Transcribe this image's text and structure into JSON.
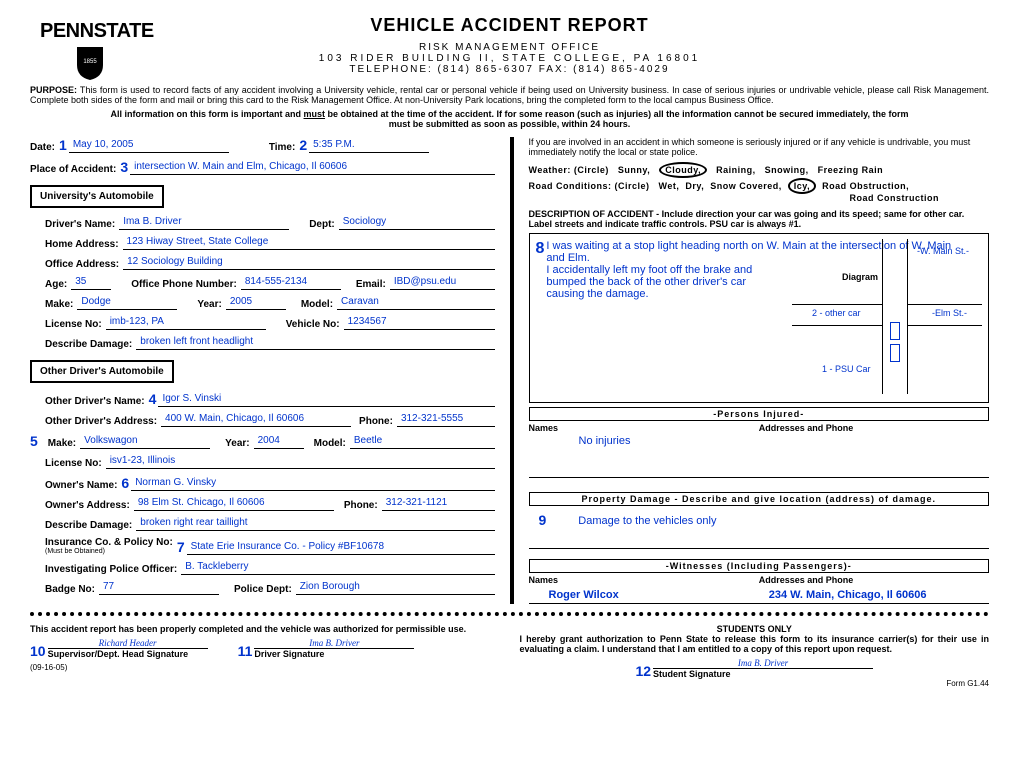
{
  "logo": {
    "text1": "PENN",
    "text2": "STATE"
  },
  "header": {
    "title": "VEHICLE ACCIDENT REPORT",
    "office": "RISK   MANAGEMENT   OFFICE",
    "address": "103  RIDER  BUILDING  II,  STATE  COLLEGE,  PA   16801",
    "phone": "TELEPHONE:  (814)  865-6307  FAX:  (814)  865-4029"
  },
  "purpose": {
    "label": "PURPOSE:",
    "text": "This form is used to record facts of any accident involving a University vehicle, rental car or personal vehicle if being used on University business.  In case of serious injuries or undrivable vehicle, please call Risk Management.  Complete both sides of the form and mail or bring this card to the Risk Management Office.  At non-University Park locations, bring the completed form to the local campus Business Office."
  },
  "important": "All information on this form is important and <u>must</u> be obtained at the time of the accident.  If for some reason (such as injuries) all the information cannot be secured immediately, the form must be submitted as soon as possible, within 24 hours.",
  "date": {
    "num": "1",
    "label": "Date:",
    "value": "May 10, 2005"
  },
  "time": {
    "num": "2",
    "label": "Time:",
    "value": "5:35 P.M."
  },
  "place": {
    "num": "3",
    "label": "Place of Accident:",
    "value": "intersection W. Main and Elm, Chicago, Il 60606"
  },
  "section1": {
    "title": "University's Automobile"
  },
  "driver": {
    "name_label": "Driver's Name:",
    "name": "Ima B. Driver",
    "dept_label": "Dept:",
    "dept": "Sociology",
    "home_label": "Home Address:",
    "home": "123 Hiway Street, State College",
    "office_label": "Office Address:",
    "office": "12 Sociology Building",
    "age_label": "Age:",
    "age": "35",
    "phone_label": "Office Phone Number:",
    "phone": "814-555-2134",
    "email_label": "Email:",
    "email": "IBD@psu.edu",
    "make_label": "Make:",
    "make": "Dodge",
    "year_label": "Year:",
    "year": "2005",
    "model_label": "Model:",
    "model": "Caravan",
    "license_label": "License No:",
    "license": "imb-123, PA",
    "vehicle_label": "Vehicle No:",
    "vehicle": "1234567",
    "damage_label": "Describe Damage:",
    "damage": "broken left front headlight"
  },
  "section2": {
    "title": "Other Driver's Automobile"
  },
  "other": {
    "num4": "4",
    "name_label": "Other Driver's Name:",
    "name": "Igor S. Vinski",
    "addr_label": "Other Driver's Address:",
    "addr": "400 W. Main, Chicago, Il 60606",
    "phone_label": "Phone:",
    "phone": "312-321-5555",
    "num5": "5",
    "make_label": "Make:",
    "make": "Volkswagon",
    "year_label": "Year:",
    "year": "2004",
    "model_label": "Model:",
    "model": "Beetle",
    "license_label": "License No:",
    "license": "isv1-23, Illinois",
    "num6": "6",
    "owner_label": "Owner's Name:",
    "owner": "Norman G. Vinsky",
    "owner_addr_label": "Owner's Address:",
    "owner_addr": "98 Elm St. Chicago, Il 60606",
    "owner_phone_label": "Phone:",
    "owner_phone": "312-321-1121",
    "damage_label": "Describe Damage:",
    "damage": "broken right rear taillight",
    "num7": "7",
    "ins_label": "Insurance Co. & Policy No:",
    "ins_note": "(Must be Obtained)",
    "ins": "State Erie Insurance Co. - Policy #BF10678",
    "officer_label": "Investigating Police Officer:",
    "officer": "B. Tackleberry",
    "badge_label": "Badge No:",
    "badge": "77",
    "dept_label": "Police Dept:",
    "dept": "Zion Borough"
  },
  "right": {
    "notify": "If you are involved in an accident in which someone is seriously injured or if any vehicle is undrivable, you must immediately notify the local or state police.",
    "weather_label": "Weather:  (Circle)",
    "weather_opts": [
      "Sunny,",
      "Cloudy,",
      "Raining,",
      "Snowing,",
      "Freezing Rain"
    ],
    "road_label": "Road Conditions:  (Circle)",
    "road_opts": [
      "Wet,",
      "Dry,",
      "Snow Covered,",
      "Icy,",
      "Road Obstruction,"
    ],
    "road_last": "Road  Construction",
    "desc_label": "DESCRIPTION OF ACCIDENT - Include direction your car was going and its speed; same  for  other  car.   Label  streets  and  indicate traffic controls.  PSU car is always #1.",
    "num8": "8",
    "desc_text1": "I was waiting at a stop light heading north on W. Main at the intersection of W. Main and Elm.",
    "desc_text2": "I accidentally left my foot off the brake and bumped the back of the other driver's car causing the damage.",
    "diagram_label": "Diagram",
    "w_main": "-W. Main St.-",
    "elm": "-Elm St.-",
    "car1": "1 - PSU Car",
    "car2": "2 - other car",
    "persons_label": "-Persons Injured-",
    "names_label": "Names",
    "addr_label": "Addresses and Phone",
    "no_injuries": "No injuries",
    "prop_label": "Property Damage - Describe and give location (address) of damage.",
    "num9": "9",
    "prop_text": "Damage to the vehicles only",
    "witness_label": "-Witnesses   (Including Passengers)-",
    "witness_name": "Roger Wilcox",
    "witness_addr": "234 W. Main, Chicago, Il 60606"
  },
  "footer": {
    "left_text": "This accident report has been properly completed and the vehicle was authorized for permissible use.",
    "num10": "10",
    "sig1": "Richard Header",
    "sig1_label": "Supervisor/Dept. Head Signature",
    "num11": "11",
    "sig2": "Ima B. Driver",
    "sig2_label": "Driver Signature",
    "date_code": "(09-16-05)",
    "students": "STUDENTS ONLY",
    "right_text": "I hereby grant authorization to Penn State to release this form to its insurance carrier(s) for their use in evaluating a claim. I understand that I am entitled to a copy of this report upon request.",
    "num12": "12",
    "sig3": "Ima B. Driver",
    "sig3_label": "Student Signature",
    "form_num": "Form G1.44"
  }
}
